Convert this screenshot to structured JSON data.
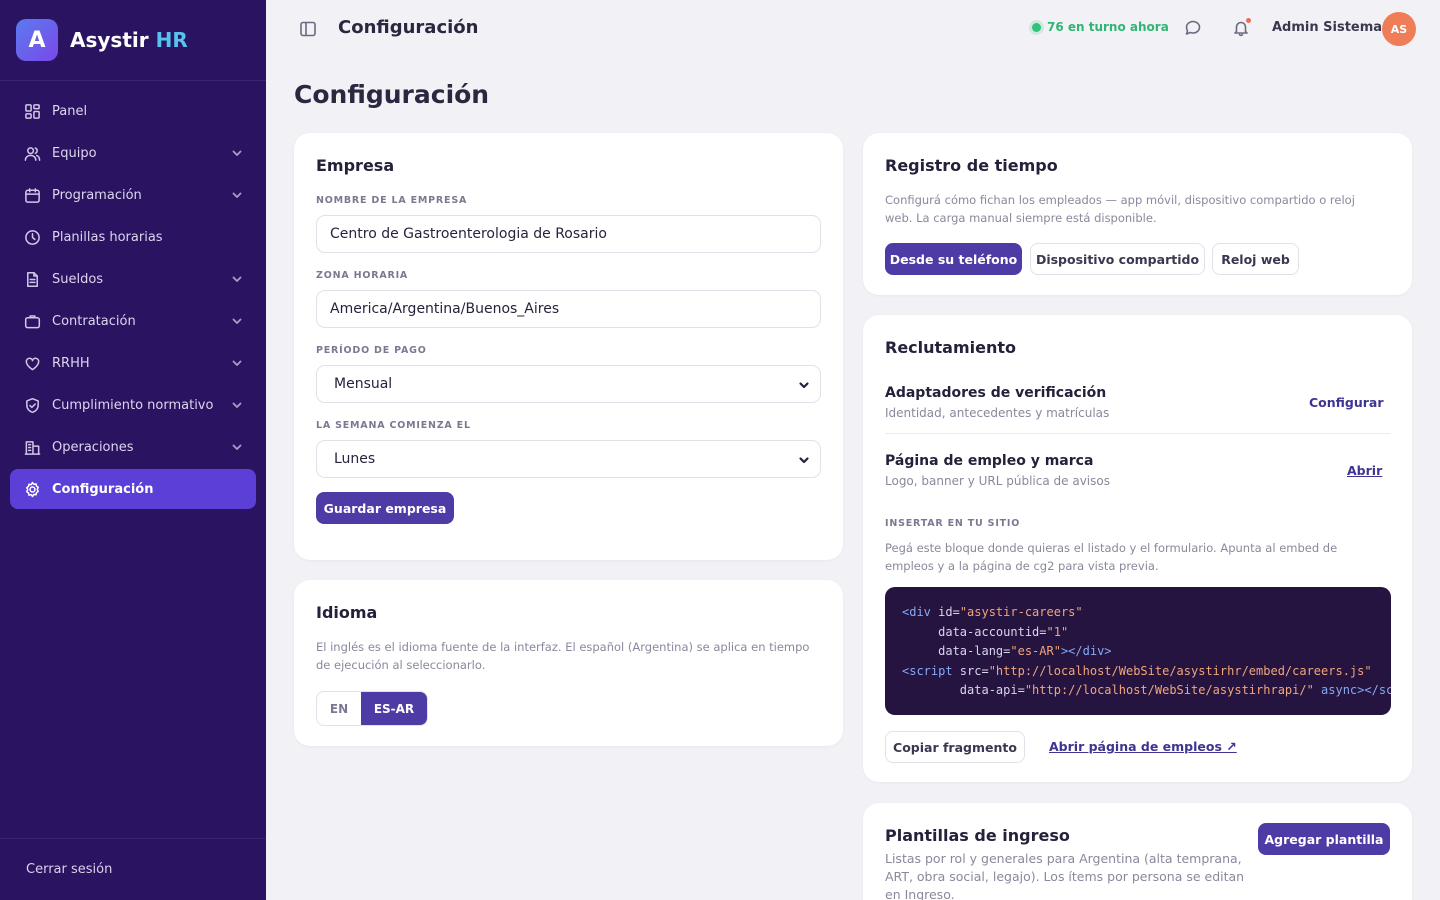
{
  "brand": {
    "logo_letter": "A",
    "name": "Asystir",
    "accent": "HR"
  },
  "sidebar": {
    "items": [
      {
        "label": "Panel"
      },
      {
        "label": "Equipo"
      },
      {
        "label": "Programación"
      },
      {
        "label": "Planillas horarias"
      },
      {
        "label": "Sueldos"
      },
      {
        "label": "Contratación"
      },
      {
        "label": "RRHH"
      },
      {
        "label": "Cumplimiento normativo"
      },
      {
        "label": "Operaciones"
      },
      {
        "label": "Configuración"
      }
    ],
    "logout": "Cerrar sesión"
  },
  "topbar": {
    "title": "Configuración",
    "on_shift": "76 en turno ahora",
    "user_name": "Admin Sistema",
    "avatar_initials": "AS"
  },
  "page": {
    "title": "Configuración"
  },
  "empresa": {
    "title": "Empresa",
    "company_name_label": "NOMBRE DE LA EMPRESA",
    "company_name_value": "Centro de Gastroenterologia de Rosario",
    "timezone_label": "ZONA HORARIA",
    "timezone_value": "America/Argentina/Buenos_Aires",
    "pay_period_label": "PERÍODO DE PAGO",
    "pay_period_value": "Mensual",
    "week_start_label": "LA SEMANA COMIENZA EL",
    "week_start_value": "Lunes",
    "save_label": "Guardar empresa"
  },
  "idioma": {
    "title": "Idioma",
    "description": "El inglés es el idioma fuente de la interfaz. El español (Argentina) se aplica en tiempo de ejecución al seleccionarlo.",
    "option_en": "EN",
    "option_es": "ES-AR"
  },
  "registro": {
    "title": "Registro de tiempo",
    "description": "Configurá cómo fichan los empleados — app móvil, dispositivo compartido o reloj web. La carga manual siempre está disponible.",
    "options": [
      "Desde su teléfono",
      "Dispositivo compartido",
      "Reloj web"
    ]
  },
  "reclutamiento": {
    "title": "Reclutamiento",
    "adapters_title": "Adaptadores de verificación",
    "adapters_sub": "Identidad, antecedentes y matrículas",
    "adapters_link": "Configurar",
    "careers_title": "Página de empleo y marca",
    "careers_sub": "Logo, banner y URL pública de avisos",
    "careers_link": "Abrir",
    "embed_label": "INSERTAR EN TU SITIO",
    "embed_description": "Pegá este bloque donde quieras el listado y el formulario. Apunta al embed de empleos y a la página de cg2 para vista previa.",
    "code": {
      "l1_tag": "<div",
      "l1_attr": " id=",
      "l1_str": "\"asystir-careers\"",
      "l2_attr": "data-accountid=",
      "l2_str": "\"1\"",
      "l3_attr": "data-lang=",
      "l3_str": "\"es-AR\"",
      "l3_end": "></div>",
      "l4_tag": "<script",
      "l4_attr": " src=",
      "l4_str": "\"http://localhost/WebSite/asystirhr/embed/careers.js\"",
      "l5_attr": "data-api=",
      "l5_str": "\"http://localhost/WebSite/asystirhrapi/\"",
      "l5_end": " async></scrip"
    },
    "copy_label": "Copiar fragmento",
    "open_careers_label": "Abrir página de empleos ↗"
  },
  "plantillas": {
    "title": "Plantillas de ingreso",
    "description": "Listas por rol y generales para Argentina (alta temprana, ART, obra social, legajo). Los ítems por persona se editan en Ingreso.",
    "add_label": "Agregar plantilla"
  },
  "colors": {
    "sidebar": "#2a1462",
    "accent": "#4f3ba6",
    "active_nav": "#5b3fd6",
    "on_shift": "#2fb574",
    "avatar": "#ef7d57"
  }
}
